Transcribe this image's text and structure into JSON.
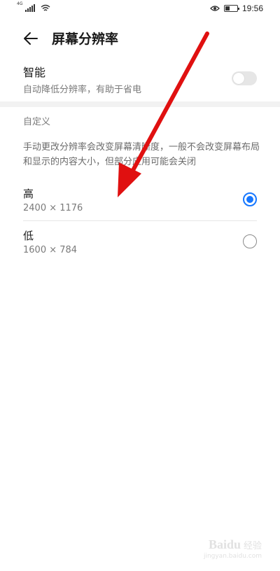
{
  "status_bar": {
    "network": "4G",
    "time": "19:56",
    "battery_level": 0.4
  },
  "header": {
    "title": "屏幕分辨率"
  },
  "smart": {
    "title": "智能",
    "subtitle": "自动降低分辨率，有助于省电",
    "enabled": false
  },
  "custom": {
    "section_label": "自定义",
    "description": "手动更改分辨率会改变屏幕清晰度，一般不会改变屏幕布局和显示的内容大小，但部分应用可能会关闭",
    "options": [
      {
        "label": "高",
        "resolution": "2400 × 1176",
        "selected": true
      },
      {
        "label": "低",
        "resolution": "1600 × 784",
        "selected": false
      }
    ]
  },
  "colors": {
    "accent": "#1677ff",
    "annotation_arrow": "#e01010"
  },
  "watermark": {
    "brand": "Baidu",
    "brand_cn": "经验",
    "url": "jingyan.baidu.com"
  }
}
